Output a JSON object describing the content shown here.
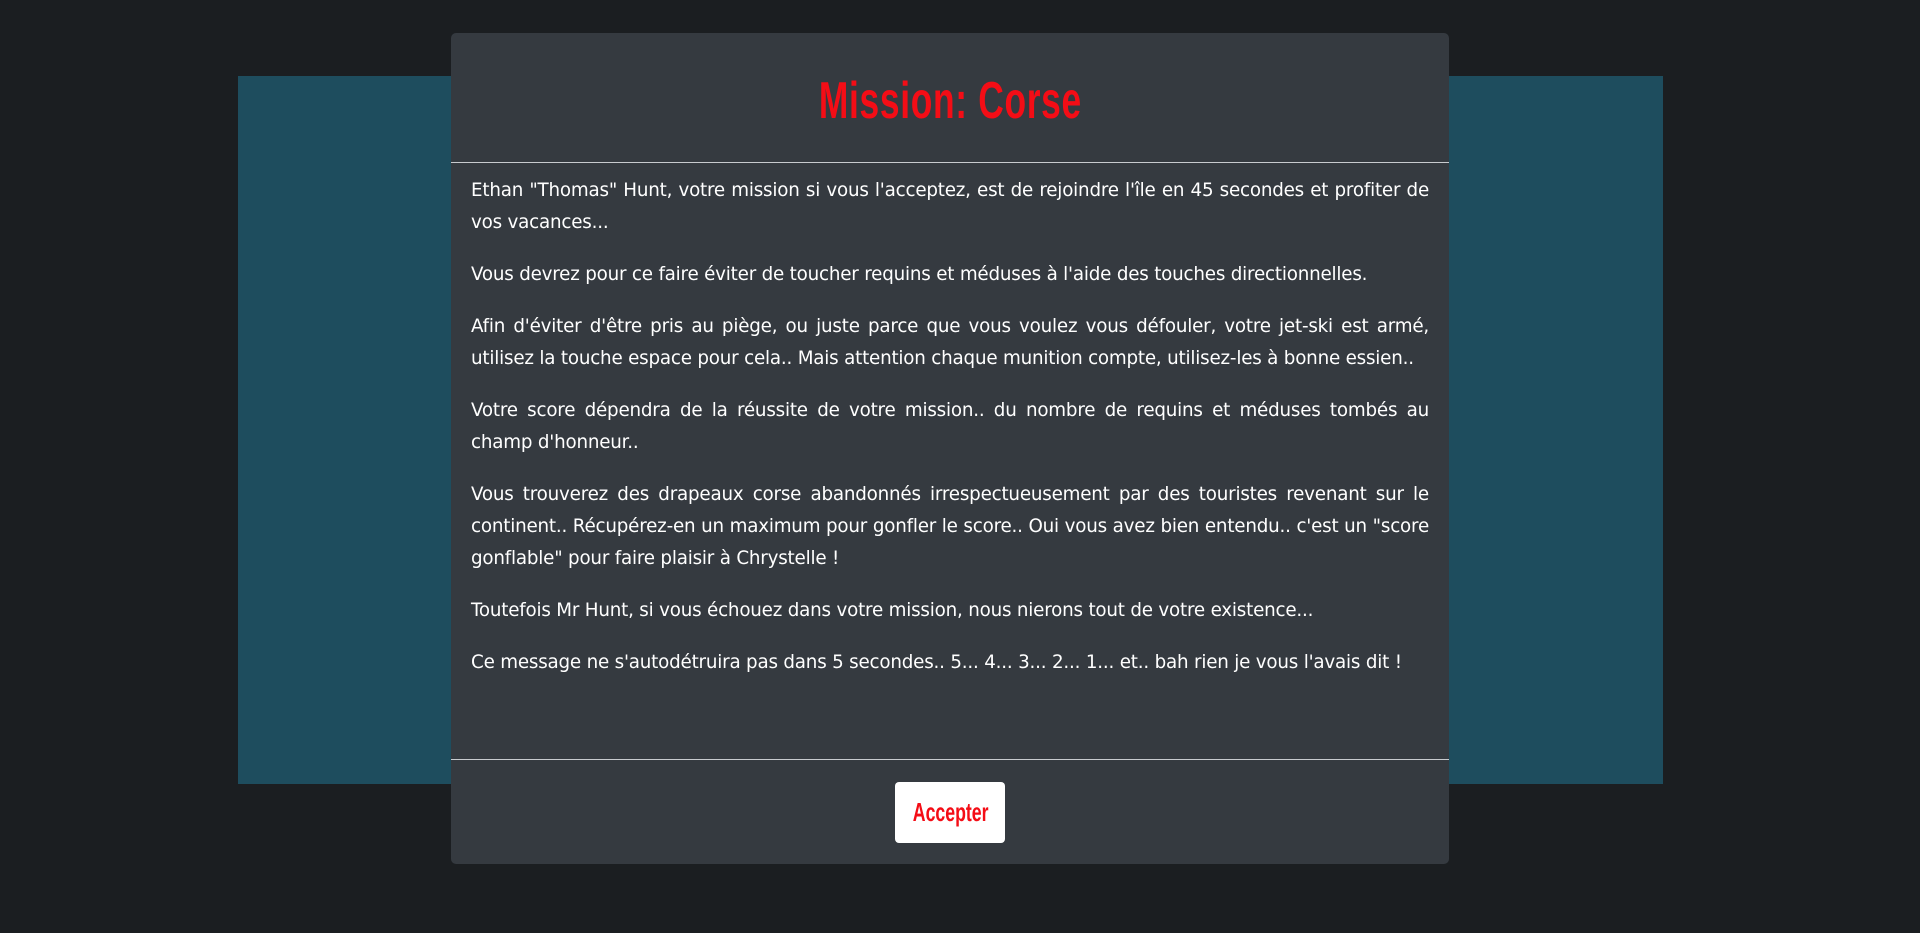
{
  "modal": {
    "title": "Mission: Corse",
    "paragraphs": [
      "Ethan \"Thomas\" Hunt, votre mission si vous l'acceptez, est de rejoindre l'île en 45 secondes et profiter de vos vacances...",
      "Vous devrez pour ce faire éviter de toucher requins et méduses à l'aide des touches directionnelles.",
      "Afin d'éviter d'être pris au piège, ou juste parce que vous voulez vous défouler, votre jet-ski est armé, utilisez la touche espace pour cela.. Mais attention chaque munition compte, utilisez-les à bonne essien..",
      "Votre score dépendra de la réussite de votre mission.. du nombre de requins et méduses tombés au champ d'honneur..",
      "Vous trouverez des drapeaux corse abandonnés irrespectueusement par des touristes revenant sur le continent.. Récupérez-en un maximum pour gonfler le score.. Oui vous avez bien entendu.. c'est un \"score gonflable\" pour faire plaisir à Chrystelle !",
      "Toutefois Mr Hunt, si vous échouez dans votre mission, nous nierons tout de votre existence...",
      "Ce message ne s'autodétruira pas dans 5 secondes.. 5... 4... 3... 2... 1... et.. bah rien je vous l'avais dit !"
    ],
    "accept_label": "Accepter"
  },
  "colors": {
    "page_background": "#1b1e21",
    "game_area": "#1e4d5e",
    "modal_background": "#353a40",
    "title_red": "#f40d16",
    "divider": "#c8cbcf"
  }
}
